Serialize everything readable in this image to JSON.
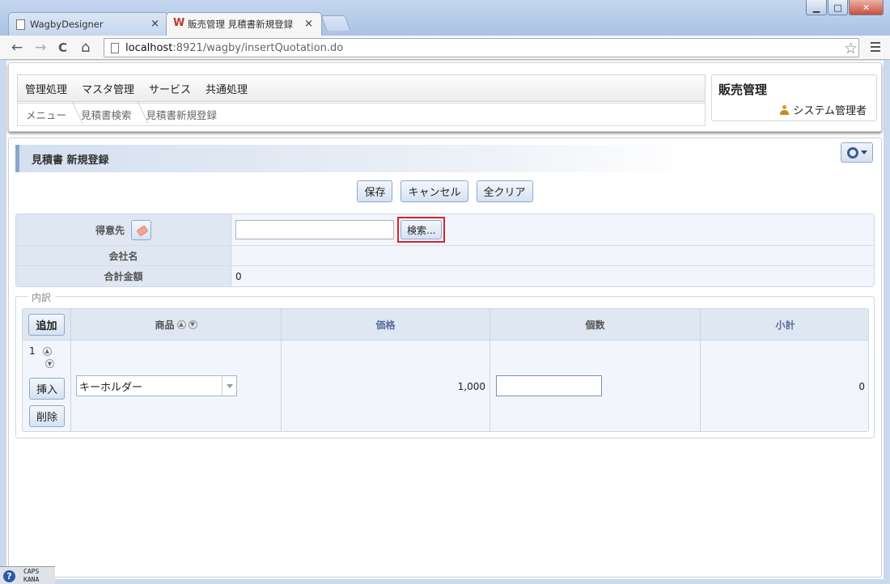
{
  "browser": {
    "tabs": [
      {
        "label": "WagbyDesigner"
      },
      {
        "label": "販売管理 見積書新規登録"
      }
    ],
    "tab_close": "×",
    "window_buttons": {
      "minimize": "▁",
      "maximize": "□",
      "close": "✕"
    },
    "url_host": "localhost",
    "url_path": ":8921/wagby/insertQuotation.do",
    "nav": {
      "back": "←",
      "forward": "→",
      "reload": "C",
      "home": "⌂",
      "star": "☆"
    }
  },
  "header": {
    "menu": [
      "管理処理",
      "マスタ管理",
      "サービス",
      "共通処理"
    ],
    "breadcrumb": [
      "メニュー",
      "見積書検索",
      "見積書新規登録"
    ],
    "app_title": "販売管理",
    "user_name": "システム管理者"
  },
  "page": {
    "section_title": "見積書 新規登録",
    "buttons": {
      "save": "保存",
      "cancel": "キャンセル",
      "clear_all": "全クリア"
    },
    "form": {
      "customer_label": "得意先",
      "customer_value": "",
      "search_button": "検索...",
      "company_label": "会社名",
      "company_value": "",
      "total_label": "合計金額",
      "total_value": "0"
    },
    "detail": {
      "legend": "内訳",
      "add_button": "追加",
      "columns": {
        "product": "商品",
        "price": "価格",
        "quantity": "個数",
        "subtotal": "小計"
      },
      "rows": [
        {
          "no": "1",
          "insert_button": "挿入",
          "delete_button": "削除",
          "product": "キーホルダー",
          "price": "1,000",
          "quantity": "",
          "subtotal": "0"
        }
      ]
    }
  },
  "statusbar": {
    "help": "?",
    "caps": "CAPS",
    "kana": "KANA"
  }
}
